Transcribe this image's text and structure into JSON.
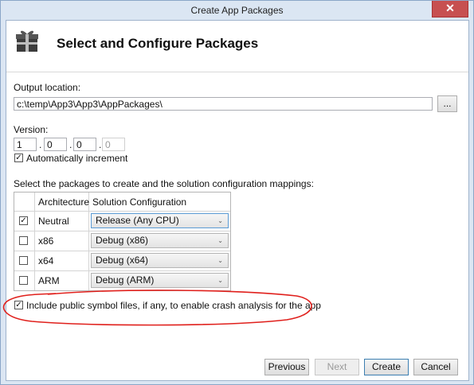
{
  "window": {
    "title": "Create App Packages",
    "close_glyph": "✕"
  },
  "header": {
    "title": "Select and Configure Packages",
    "icon": "package-gift-icon"
  },
  "output": {
    "label": "Output location:",
    "value": "c:\\temp\\App3\\App3\\AppPackages\\",
    "browse_label": "..."
  },
  "version": {
    "label": "Version:",
    "parts": [
      "1",
      "0",
      "0",
      "0"
    ],
    "auto_increment_label": "Automatically increment",
    "auto_increment_checked": true
  },
  "packages": {
    "instruction": "Select the packages to create and the solution configuration mappings:",
    "headers": [
      "Architecture",
      "Solution Configuration"
    ],
    "rows": [
      {
        "checked": true,
        "arch": "Neutral",
        "config": "Release (Any CPU)"
      },
      {
        "checked": false,
        "arch": "x86",
        "config": "Debug (x86)"
      },
      {
        "checked": false,
        "arch": "x64",
        "config": "Debug (x64)"
      },
      {
        "checked": false,
        "arch": "ARM",
        "config": "Debug (ARM)"
      }
    ]
  },
  "symbols": {
    "label": "Include public symbol files, if any, to enable crash analysis for the app",
    "checked": true
  },
  "buttons": {
    "previous": "Previous",
    "next": "Next",
    "create": "Create",
    "cancel": "Cancel"
  },
  "colors": {
    "annotation_red": "#e0201c",
    "window_border": "#8aa6c8"
  }
}
